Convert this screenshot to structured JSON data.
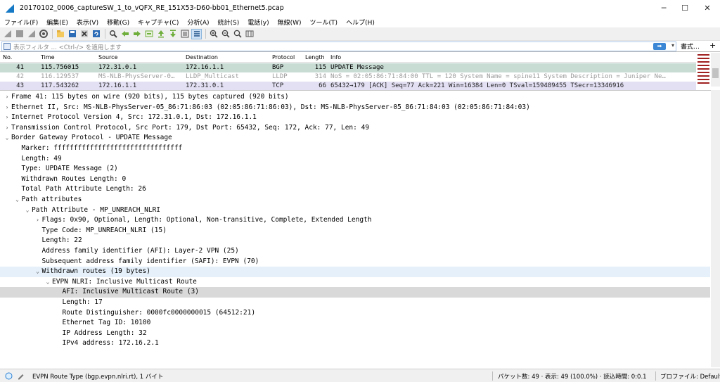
{
  "window": {
    "title": "20170102_0006_captureSW_1_to_vQFX_RE_151X53-D60-bb01_Ethernet5.pcap",
    "minimize": "─",
    "maximize": "☐",
    "close": "✕"
  },
  "menu": [
    "ファイル(F)",
    "編集(E)",
    "表示(V)",
    "移動(G)",
    "キャプチャ(C)",
    "分析(A)",
    "統計(S)",
    "電話(y)",
    "無線(W)",
    "ツール(T)",
    "ヘルプ(H)"
  ],
  "filter": {
    "placeholder": "表示フィルタ … <Ctrl-/> を適用します",
    "apply_icon": "➡",
    "dropdown_icon": "▾",
    "expression_label": "書式…",
    "plus_label": "+"
  },
  "packet_list": {
    "columns": [
      "No.",
      "Time",
      "Source",
      "Destination",
      "Protocol",
      "Length",
      "Info"
    ],
    "rows": [
      {
        "no": "41",
        "time": "115.756015",
        "source": "172.31.0.1",
        "destination": "172.16.1.1",
        "protocol": "BGP",
        "length": "115",
        "info": "UPDATE Message",
        "bg": "#c8dcd4",
        "fg": "#000000"
      },
      {
        "no": "42",
        "time": "116.129537",
        "source": "MS-NLB-PhysServer-0…",
        "destination": "LLDP_Multicast",
        "protocol": "LLDP",
        "length": "314",
        "info": "NoS = 02:05:86:71:84:00 TTL = 120 System Name = spine11 System Description = Juniper Ne…",
        "bg": "#ffffff",
        "fg": "#9a9a9a"
      },
      {
        "no": "43",
        "time": "117.543262",
        "source": "172.16.1.1",
        "destination": "172.31.0.1",
        "protocol": "TCP",
        "length": "66",
        "info": "65432→179 [ACK] Seq=77 Ack=221 Win=16384 Len=0 TSval=159489455 TSecr=13346916",
        "bg": "#e4e0f4",
        "fg": "#222222"
      }
    ]
  },
  "details": [
    {
      "text": "Frame 41: 115 bytes on wire (920 bits), 115 bytes captured (920 bits)",
      "indent": 0,
      "arrow": "›",
      "style": ""
    },
    {
      "text": "Ethernet II, Src: MS-NLB-PhysServer-05_86:71:86:03 (02:05:86:71:86:03), Dst: MS-NLB-PhysServer-05_86:71:84:03 (02:05:86:71:84:03)",
      "indent": 0,
      "arrow": "›",
      "style": ""
    },
    {
      "text": "Internet Protocol Version 4, Src: 172.31.0.1, Dst: 172.16.1.1",
      "indent": 0,
      "arrow": "›",
      "style": ""
    },
    {
      "text": "Transmission Control Protocol, Src Port: 179, Dst Port: 65432, Seq: 172, Ack: 77, Len: 49",
      "indent": 0,
      "arrow": "›",
      "style": ""
    },
    {
      "text": "Border Gateway Protocol - UPDATE Message",
      "indent": 0,
      "arrow": "⌄",
      "style": ""
    },
    {
      "text": "Marker: ffffffffffffffffffffffffffffffff",
      "indent": 1,
      "arrow": "",
      "style": ""
    },
    {
      "text": "Length: 49",
      "indent": 1,
      "arrow": "",
      "style": ""
    },
    {
      "text": "Type: UPDATE Message (2)",
      "indent": 1,
      "arrow": "",
      "style": ""
    },
    {
      "text": "Withdrawn Routes Length: 0",
      "indent": 1,
      "arrow": "",
      "style": ""
    },
    {
      "text": "Total Path Attribute Length: 26",
      "indent": 1,
      "arrow": "",
      "style": ""
    },
    {
      "text": "Path attributes",
      "indent": 1,
      "arrow": "⌄",
      "style": ""
    },
    {
      "text": "Path Attribute - MP_UNREACH_NLRI",
      "indent": 2,
      "arrow": "⌄",
      "style": ""
    },
    {
      "text": "Flags: 0x90, Optional, Length: Optional, Non-transitive, Complete, Extended Length",
      "indent": 3,
      "arrow": "›",
      "style": ""
    },
    {
      "text": "Type Code: MP_UNREACH_NLRI (15)",
      "indent": 3,
      "arrow": "",
      "style": ""
    },
    {
      "text": "Length: 22",
      "indent": 3,
      "arrow": "",
      "style": ""
    },
    {
      "text": "Address family identifier (AFI): Layer-2 VPN (25)",
      "indent": 3,
      "arrow": "",
      "style": ""
    },
    {
      "text": "Subsequent address family identifier (SAFI): EVPN (70)",
      "indent": 3,
      "arrow": "",
      "style": ""
    },
    {
      "text": "Withdrawn routes (19 bytes)",
      "indent": 3,
      "arrow": "⌄",
      "style": "hl"
    },
    {
      "text": "EVPN NLRI: Inclusive Multicast Route",
      "indent": 4,
      "arrow": "⌄",
      "style": ""
    },
    {
      "text": "AFI: Inclusive Multicast Route (3)",
      "indent": 5,
      "arrow": "",
      "style": "sel"
    },
    {
      "text": "Length: 17",
      "indent": 5,
      "arrow": "",
      "style": ""
    },
    {
      "text": "Route Distinguisher: 0000fc0000000015 (64512:21)",
      "indent": 5,
      "arrow": "",
      "style": ""
    },
    {
      "text": "Ethernet Tag ID: 10100",
      "indent": 5,
      "arrow": "",
      "style": ""
    },
    {
      "text": "IP Address Length: 32",
      "indent": 5,
      "arrow": "",
      "style": ""
    },
    {
      "text": "IPv4 address: 172.16.2.1",
      "indent": 5,
      "arrow": "",
      "style": ""
    }
  ],
  "status": {
    "field_text": "EVPN Route Type (bgp.evpn.nlri.rt), 1 バイト",
    "packets_text": "パケット数: 49 · 表示: 49 (100.0%) · 読込時間: 0:0.1",
    "profile_text": "プロファイル: Default"
  },
  "colors": {
    "accent": "#3b87d6",
    "bgp_row": "#c8dcd4",
    "tcp_row": "#e4e0f4",
    "highlight": "#e5f0fa",
    "selected": "#d9d9d9"
  }
}
